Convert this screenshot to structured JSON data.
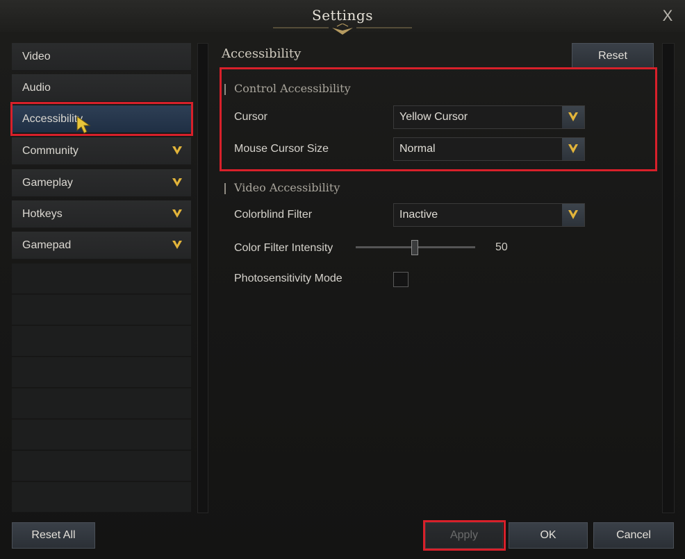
{
  "window": {
    "title": "Settings",
    "close_label": "X"
  },
  "sidebar": {
    "items": [
      {
        "label": "Video",
        "expandable": false
      },
      {
        "label": "Audio",
        "expandable": false
      },
      {
        "label": "Accessibility",
        "expandable": false,
        "active": true
      },
      {
        "label": "Community",
        "expandable": true
      },
      {
        "label": "Gameplay",
        "expandable": true
      },
      {
        "label": "Hotkeys",
        "expandable": true
      },
      {
        "label": "Gamepad",
        "expandable": true
      }
    ]
  },
  "main": {
    "section_title": "Accessibility",
    "reset_label": "Reset",
    "control_accessibility": {
      "title": "Control Accessibility",
      "cursor": {
        "label": "Cursor",
        "value": "Yellow Cursor"
      },
      "cursor_size": {
        "label": "Mouse Cursor Size",
        "value": "Normal"
      }
    },
    "video_accessibility": {
      "title": "Video Accessibility",
      "colorblind_filter": {
        "label": "Colorblind Filter",
        "value": "Inactive"
      },
      "color_filter_intensity": {
        "label": "Color Filter Intensity",
        "value": "50",
        "max": 100
      },
      "photosensitivity": {
        "label": "Photosensitivity Mode",
        "checked": false
      }
    }
  },
  "footer": {
    "reset_all_label": "Reset All",
    "apply_label": "Apply",
    "ok_label": "OK",
    "cancel_label": "Cancel"
  },
  "colors": {
    "accent_highlight": "#d8202a",
    "chevron": "#e2b43a",
    "active_item": "#24364d"
  }
}
